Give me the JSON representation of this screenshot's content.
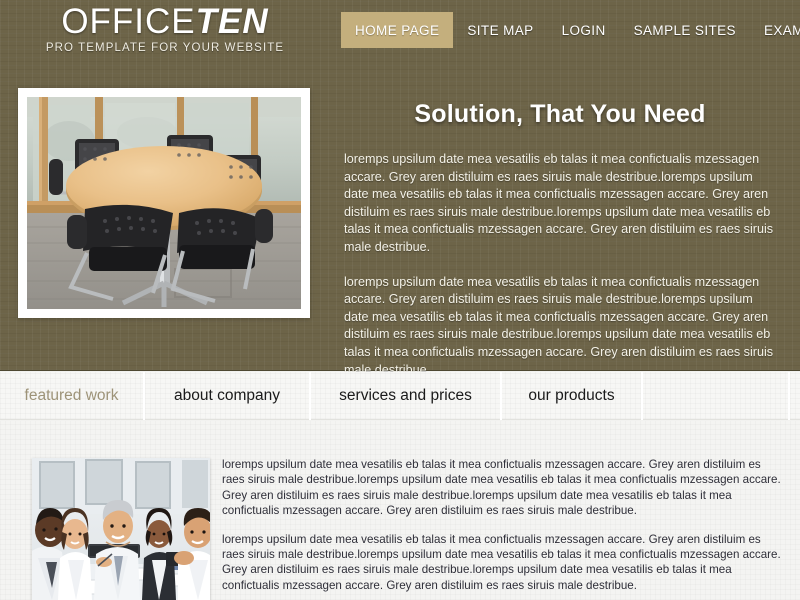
{
  "site": {
    "logo_light": "OFFICE",
    "logo_bold": "TEN",
    "tagline": "PRO TEMPLATE FOR YOUR WEBSITE"
  },
  "colors": {
    "background_dark": "#6d6448",
    "nav_active_bg": "#c4af7d",
    "tab_active_text": "#9d9378",
    "body_text_light": "#f4f2e8",
    "bottom_bg": "#f4f4f2"
  },
  "nav": {
    "items": [
      {
        "label": "HOME PAGE",
        "active": true
      },
      {
        "label": "SITE MAP",
        "active": false
      },
      {
        "label": "LOGIN",
        "active": false
      },
      {
        "label": "SAMPLE SITES",
        "active": false
      },
      {
        "label": "EXAMPLE PAGES",
        "active": false
      }
    ]
  },
  "hero": {
    "image_alt": "conference-room-round-table-with-black-chairs",
    "heading": "Solution, That You Need",
    "paragraphs": [
      "loremps upsilum date mea vesatilis eb talas it mea confictualis mzessagen accare. Grey aren distiluim es raes siruis male destribue.loremps upsilum date mea vesatilis eb talas it mea confictualis mzessagen accare. Grey aren distiluim es raes siruis male destribue.loremps upsilum date mea vesatilis eb talas it mea confictualis mzessagen accare. Grey aren distiluim es raes siruis male destribue.",
      "loremps upsilum date mea vesatilis eb talas it mea confictualis mzessagen accare. Grey aren distiluim es raes siruis male destribue.loremps upsilum date mea vesatilis eb talas it mea confictualis mzessagen accare. Grey aren distiluim es raes siruis male destribue.loremps upsilum date mea vesatilis eb talas it mea confictualis mzessagen accare. Grey aren distiluim es raes siruis male destribue."
    ]
  },
  "tabs": {
    "items": [
      {
        "label": "featured work",
        "active": true
      },
      {
        "label": "about company",
        "active": false
      },
      {
        "label": "services and prices",
        "active": false
      },
      {
        "label": "our products",
        "active": false
      }
    ]
  },
  "panel": {
    "image_alt": "business-team-meeting-five-people-at-table",
    "paragraphs": [
      "loremps upsilum date mea vesatilis eb talas it mea confictualis mzessagen accare. Grey aren distiluim es raes siruis male destribue.loremps upsilum date mea vesatilis eb talas it mea confictualis mzessagen accare. Grey aren distiluim es raes siruis male destribue.loremps upsilum date mea vesatilis eb talas it mea confictualis mzessagen accare. Grey aren distiluim es raes siruis male destribue.",
      "loremps upsilum date mea vesatilis eb talas it mea confictualis mzessagen accare. Grey aren distiluim es raes siruis male destribue.loremps upsilum date mea vesatilis eb talas it mea confictualis mzessagen accare. Grey aren distiluim es raes siruis male destribue.loremps upsilum date mea vesatilis eb talas it mea confictualis mzessagen accare. Grey aren distiluim es raes siruis male destribue."
    ]
  }
}
